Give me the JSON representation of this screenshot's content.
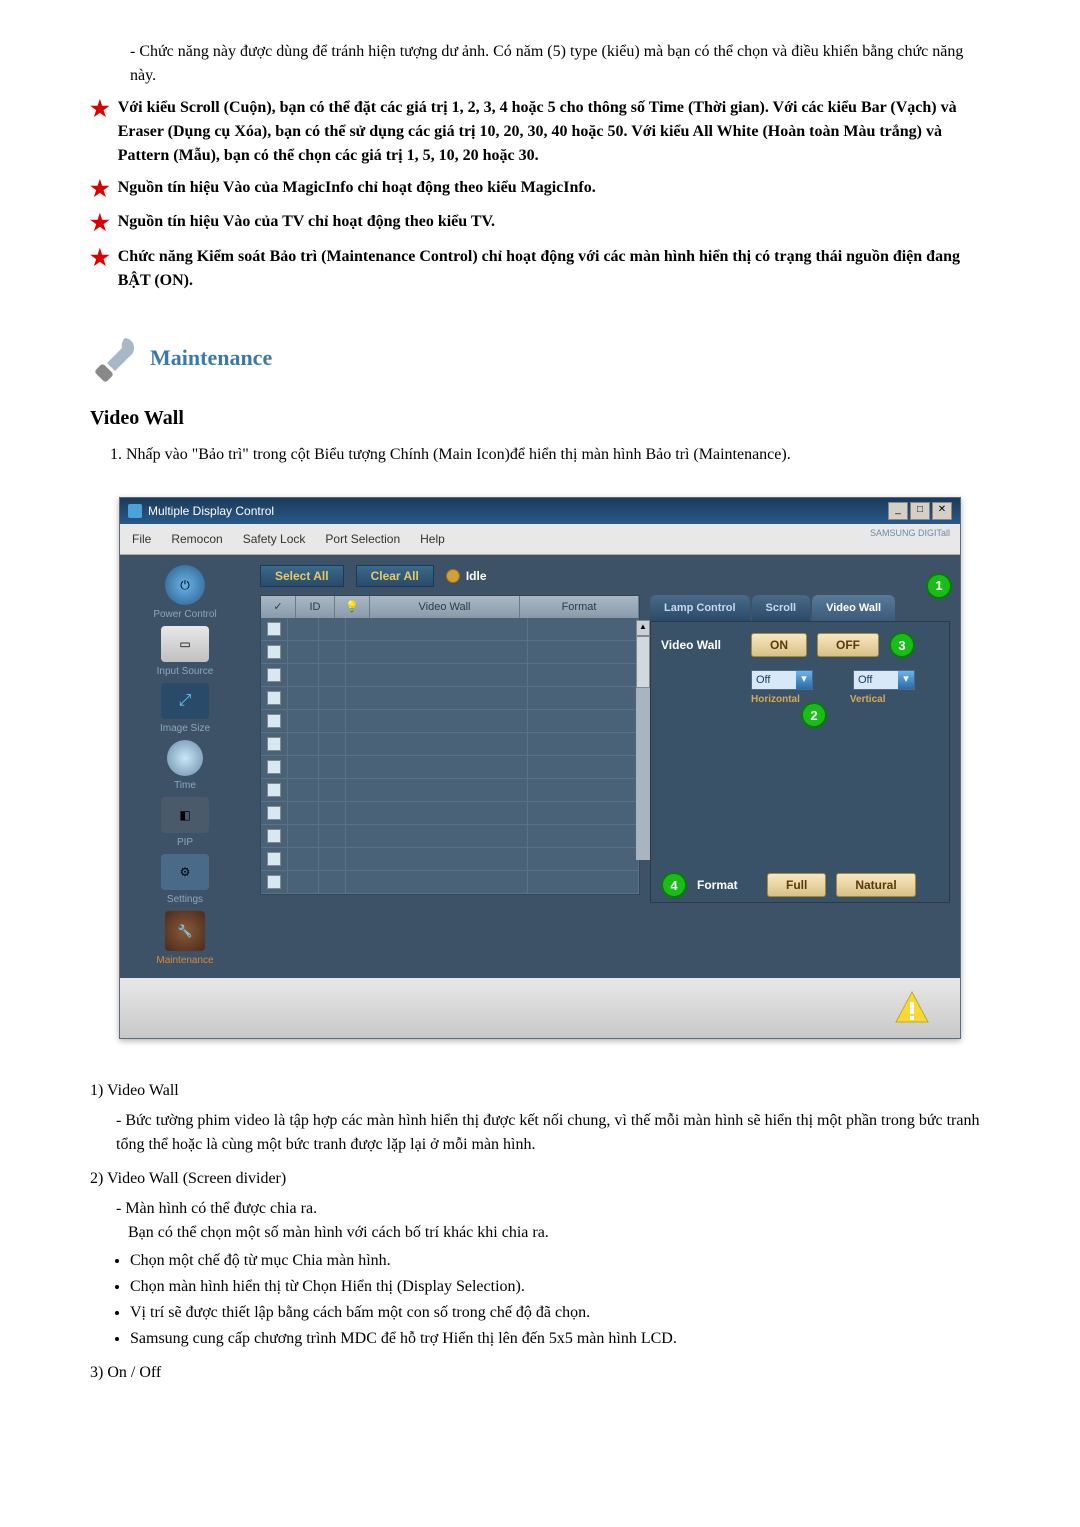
{
  "intro": {
    "dash": "- Chức năng này được dùng để tránh hiện tượng dư ảnh. Có năm (5) type (kiểu) mà bạn có thể chọn và điều khiển bằng chức năng này."
  },
  "stars": [
    "Với kiểu Scroll (Cuộn), bạn có thể đặt các giá trị 1, 2, 3, 4 hoặc 5 cho thông số Time (Thời gian). Với các kiểu Bar (Vạch) và Eraser (Dụng cụ Xóa), bạn có thể sử dụng các giá trị 10, 20, 30, 40 hoặc 50. Với kiểu All White (Hoàn toàn Màu trắng) và Pattern (Mẫu), bạn có thể chọn các giá trị 1, 5, 10, 20 hoặc 30.",
    "Nguồn tín hiệu Vào của MagicInfo chỉ hoạt động theo kiểu MagicInfo.",
    "Nguồn tín hiệu Vào của TV chỉ hoạt động theo kiểu TV.",
    "Chức năng Kiểm soát Bảo trì (Maintenance Control) chỉ hoạt động với các màn hình hiển thị có trạng thái nguồn điện đang BẬT (ON)."
  ],
  "maintSection": "Maintenance",
  "videoWall": "Video Wall",
  "step1": "1.  Nhấp vào \"Bảo trì\" trong cột Biểu tượng Chính (Main Icon)để hiển thị màn hình Bảo trì (Maintenance).",
  "app": {
    "title": "Multiple Display Control",
    "menus": [
      "File",
      "Remocon",
      "Safety Lock",
      "Port Selection",
      "Help"
    ],
    "samsung": "SAMSUNG DIGITall",
    "sidebar": [
      {
        "label": "Power Control",
        "icon": "power"
      },
      {
        "label": "Input Source",
        "icon": "input"
      },
      {
        "label": "Image Size",
        "icon": "imgsize"
      },
      {
        "label": "Time",
        "icon": "time"
      },
      {
        "label": "PIP",
        "icon": "pip"
      },
      {
        "label": "Settings",
        "icon": "settings"
      },
      {
        "label": "Maintenance",
        "icon": "maint",
        "active": true
      }
    ],
    "toolbar": {
      "select": "Select All",
      "clear": "Clear All",
      "idle": "Idle"
    },
    "gridHeaders": {
      "chk": "✓",
      "id": "ID",
      "lamp": "💡",
      "vw": "Video Wall",
      "fmt": "Format"
    },
    "rows": 12,
    "tabs": {
      "lamp": "Lamp Control",
      "scroll": "Scroll",
      "vw": "Video Wall"
    },
    "panel": {
      "vwLabel": "Video Wall",
      "on": "ON",
      "off": "OFF",
      "hDrop": "Off",
      "vDrop": "Off",
      "hLabel": "Horizontal",
      "vLabel": "Vertical",
      "fmtLabel": "Format",
      "full": "Full",
      "natural": "Natural"
    }
  },
  "desc": {
    "n1": "1)  Video Wall",
    "n1text": "- Bức tường phim video là tập hợp các màn hình hiển thị được kết nối chung, vì thế mỗi màn hình sẽ hiển thị một phần trong bức tranh tổng thể hoặc là cùng một bức tranh được lặp lại ở mỗi màn hình.",
    "n2": "2)  Video Wall (Screen divider)",
    "n2a": "- Màn hình có thể được chia ra.",
    "n2b": "Bạn có thể chọn một số màn hình với cách bố trí khác khi chia ra.",
    "bullets": [
      "Chọn một chế độ từ mục Chia màn hình.",
      "Chọn màn hình hiển thị từ Chọn Hiển thị (Display Selection).",
      "Vị trí sẽ được thiết lập bằng cách bấm một con số trong chế độ đã chọn.",
      "Samsung cung cấp chương trình MDC để hỗ trợ Hiển thị lên đến 5x5 màn hình LCD."
    ],
    "n3": "3)  On / Off"
  }
}
